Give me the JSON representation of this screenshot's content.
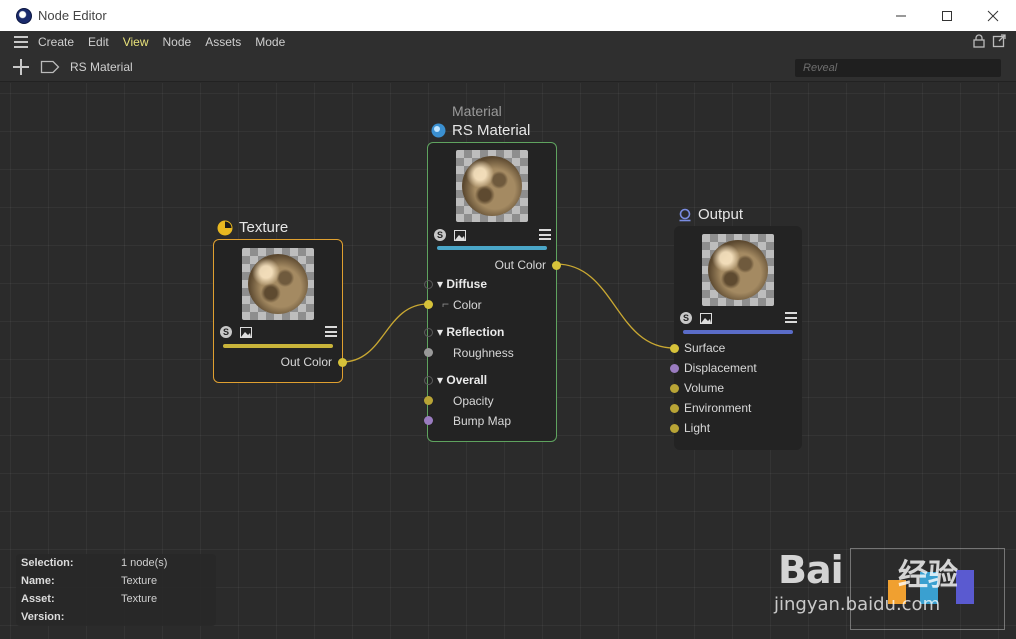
{
  "window": {
    "title": "Node Editor"
  },
  "menu": {
    "items": [
      "Create",
      "Edit",
      "View",
      "Node",
      "Assets",
      "Mode"
    ],
    "active": "View"
  },
  "toolbar": {
    "breadcrumb": "RS Material",
    "search_placeholder": "Reveal"
  },
  "nodes": {
    "texture": {
      "title": "Texture",
      "icon": "texture-node-icon",
      "accent": "#e0a030",
      "bar_color": "#c9b43a",
      "output": "Out Color"
    },
    "material": {
      "subtitle": "Material",
      "title": "RS Material",
      "icon": "material-node-icon",
      "accent": "#5fa35f",
      "bar_color": "#4aa6c8",
      "output": "Out Color",
      "groups": [
        {
          "label": "Diffuse",
          "ports": [
            "Color"
          ]
        },
        {
          "label": "Reflection",
          "ports": [
            "Roughness"
          ]
        },
        {
          "label": "Overall",
          "ports": [
            "Opacity",
            "Bump Map"
          ]
        }
      ]
    },
    "output": {
      "title": "Output",
      "icon": "output-node-icon",
      "bar_color": "#5a6cc8",
      "inputs": [
        "Surface",
        "Displacement",
        "Volume",
        "Environment",
        "Light"
      ]
    }
  },
  "colors": {
    "wire": "#c9a832",
    "port_yellow": "#d6c23a",
    "port_purple": "#9a7cc0",
    "port_gray": "#9a9a9a"
  },
  "info": {
    "selection_key": "Selection:",
    "selection_val": "1 node(s)",
    "name_key": "Name:",
    "name_val": "Texture",
    "asset_key": "Asset:",
    "asset_val": "Texture",
    "version_key": "Version:",
    "version_val": ""
  },
  "watermark": {
    "brand": "Bai",
    "brand2": "经验",
    "url": "jingyan.baidu.com"
  }
}
